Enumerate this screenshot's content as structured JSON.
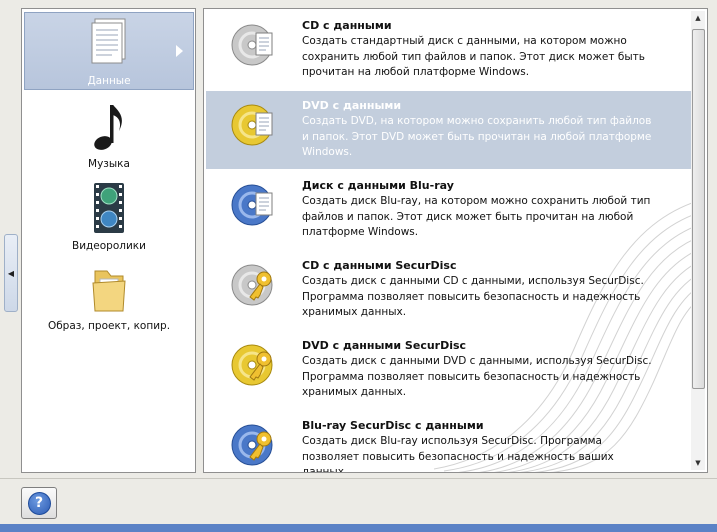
{
  "sidebar": {
    "items": [
      {
        "label": "Данные",
        "icon": "document-icon",
        "selected": true
      },
      {
        "label": "Музыка",
        "icon": "music-note-icon",
        "selected": false
      },
      {
        "label": "Видеоролики",
        "icon": "film-reel-icon",
        "selected": false
      },
      {
        "label": "Образ, проект, копир.",
        "icon": "folder-icon",
        "selected": false
      }
    ]
  },
  "content": {
    "items": [
      {
        "title": "CD с данными",
        "desc": "Создать стандартный диск с данными, на котором можно сохранить любой тип файлов и папок. Этот диск может быть прочитан на любой платформе Windows.",
        "icon": "cd-data-icon",
        "disc_color": "#c8c8c8",
        "selected": false
      },
      {
        "title": "DVD с данными",
        "desc": "Создать DVD, на котором можно сохранить любой тип файлов и папок. Этот DVD может быть прочитан на любой платформе Windows.",
        "icon": "dvd-data-icon",
        "disc_color": "#e8c832",
        "selected": true
      },
      {
        "title": "Диск с данными Blu-ray",
        "desc": "Создать диск Blu-ray, на котором можно сохранить любой тип файлов и папок. Этот диск может быть прочитан на любой платформе Windows.",
        "icon": "bluray-data-icon",
        "disc_color": "#4a78c8",
        "selected": false
      },
      {
        "title": "CD с данными SecurDisc",
        "desc": "Создать диск с данными CD с данными, используя SecurDisc. Программа позволяет повысить безопасность и надежность хранимых данных.",
        "icon": "cd-securdisc-icon",
        "disc_color": "#c8c8c8",
        "selected": false
      },
      {
        "title": "DVD с данными SecurDisc",
        "desc": "Создать диск с данными DVD с данными, используя SecurDisc. Программа позволяет повысить безопасность и надежность хранимых данных.",
        "icon": "dvd-securdisc-icon",
        "disc_color": "#e8c832",
        "selected": false
      },
      {
        "title": "Blu-ray SecurDisc с данными",
        "desc": "Создать диск Blu-ray используя SecurDisc. Программа позволяет повысить безопасность и надежность ваших данных",
        "icon": "bluray-securdisc-icon",
        "disc_color": "#4a78c8",
        "selected": false
      }
    ]
  },
  "footer": {
    "help_icon": "help-icon",
    "help_label": "?"
  },
  "colors": {
    "selection": "#c3cedd",
    "sidebar_selection": "#b7c5dc",
    "bottom_strip": "#5b82c6"
  }
}
